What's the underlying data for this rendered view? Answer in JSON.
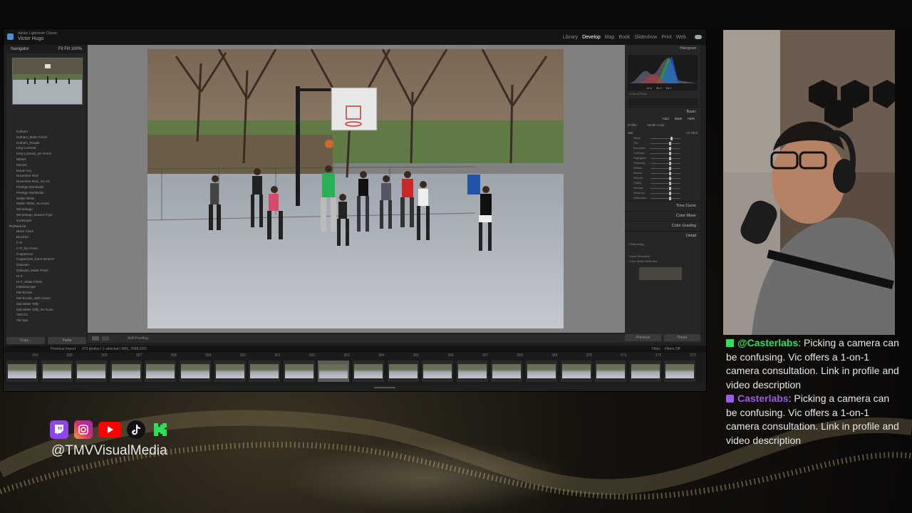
{
  "lightroom": {
    "app_name": "Adobe Lightroom Classic",
    "user_name": "Victor Hugo",
    "modules": [
      {
        "label": "Library",
        "active": false
      },
      {
        "label": "Develop",
        "active": true
      },
      {
        "label": "Map",
        "active": false
      },
      {
        "label": "Book",
        "active": false
      },
      {
        "label": "Slideshow",
        "active": false
      },
      {
        "label": "Print",
        "active": false
      },
      {
        "label": "Web",
        "active": false
      }
    ],
    "navigator": {
      "title": "Navigator",
      "zoom_options": [
        "Fit",
        "Fill",
        "100%"
      ]
    },
    "presets": [
      {
        "label": "Gotham",
        "group": false
      },
      {
        "label": "Gotham_Matte Finish",
        "group": false
      },
      {
        "label": "Gotham_People",
        "group": false
      },
      {
        "label": "King Contrast",
        "group": false
      },
      {
        "label": "King Contrast_No Green",
        "group": false
      },
      {
        "label": "MOMA",
        "group": false
      },
      {
        "label": "Montes",
        "group": false
      },
      {
        "label": "Mount Airy",
        "group": false
      },
      {
        "label": "November Rain",
        "group": false
      },
      {
        "label": "November Rain_No VG",
        "group": false
      },
      {
        "label": "Prestige Worldwide",
        "group": false
      },
      {
        "label": "Prestige Worldwide",
        "group": false
      },
      {
        "label": "Walter White",
        "group": false
      },
      {
        "label": "Walter White_No Grain",
        "group": false
      },
      {
        "label": "Winnebago",
        "group": false
      },
      {
        "label": "Winnebago_Erased Fogs",
        "group": false
      },
      {
        "label": "Zookeeper",
        "group": false
      },
      {
        "label": "ProPack 04",
        "group": true
      },
      {
        "label": "Blues Clues",
        "group": false
      },
      {
        "label": "Brooklyn",
        "group": false
      },
      {
        "label": "C-R",
        "group": false
      },
      {
        "label": "C-R_No Green",
        "group": false
      },
      {
        "label": "Coppertone",
        "group": false
      },
      {
        "label": "Coppertone_Extra Bronzer",
        "group": false
      },
      {
        "label": "Galaxian",
        "group": false
      },
      {
        "label": "Galaxian_Matte Finish",
        "group": false
      },
      {
        "label": "Hi-C",
        "group": false
      },
      {
        "label": "Hi-C_Matte Finish",
        "group": false
      },
      {
        "label": "Kaleidoscope",
        "group": false
      },
      {
        "label": "Mel Brooks",
        "group": false
      },
      {
        "label": "Mel Brooks_With Green",
        "group": false
      },
      {
        "label": "Salt Water Taffy",
        "group": false
      },
      {
        "label": "Salt Water Taffy_No Grain",
        "group": false
      },
      {
        "label": "TMCCC",
        "group": false
      },
      {
        "label": "Tiki Spa",
        "group": false
      }
    ],
    "left_buttons": {
      "copy": "Copy...",
      "paste": "Paste"
    },
    "toolbar": {
      "softproof": "Soft Proofing"
    },
    "right_panel": {
      "histogram_title": "Histogram",
      "histogram_readout": [
        "15.8",
        "35.4",
        "53.3"
      ],
      "original_photo": "Original Photo",
      "basic_title": "Basic",
      "treatment": [
        "Auto",
        "B&W",
        "HDR"
      ],
      "profile_label": "Profile",
      "profile_value": "Adobe Color",
      "wb_label": "WB",
      "wb_value": "As Shot",
      "sliders": [
        {
          "name": "Temp",
          "pos": 0.55
        },
        {
          "name": "Tint",
          "pos": 0.5
        },
        {
          "name": "Exposure",
          "pos": 0.5
        },
        {
          "name": "Contrast",
          "pos": 0.5
        },
        {
          "name": "Highlights",
          "pos": 0.5
        },
        {
          "name": "Shadows",
          "pos": 0.5
        },
        {
          "name": "Whites",
          "pos": 0.5
        },
        {
          "name": "Blacks",
          "pos": 0.5
        },
        {
          "name": "Texture",
          "pos": 0.5
        },
        {
          "name": "Clarity",
          "pos": 0.5
        },
        {
          "name": "Dehaze",
          "pos": 0.5
        },
        {
          "name": "Vibrance",
          "pos": 0.5
        },
        {
          "name": "Saturation",
          "pos": 0.5
        }
      ],
      "presence_label": "Presence",
      "tone_label": "Tone",
      "sections": [
        "Tone Curve",
        "Color Mixer",
        "Color Grading",
        "Detail"
      ],
      "detail_items": [
        "Sharpening",
        "Noise Reduction",
        "Color Noise Reduction"
      ],
      "buttons": {
        "previous": "Previous",
        "reset": "Reset"
      }
    },
    "filmbar": {
      "source": "Previous Import",
      "count": "473 photos / 1 selected / IMG_7998.CR3",
      "filter": "Filter:",
      "filter_value": "Filters Off"
    },
    "film_numbers": [
      "354",
      "355",
      "356",
      "357",
      "358",
      "359",
      "360",
      "361",
      "362",
      "363",
      "364",
      "365",
      "366",
      "367",
      "368",
      "369",
      "370",
      "371",
      "372",
      "373"
    ],
    "selected_index": 9
  },
  "chat": [
    {
      "platform": "kick",
      "user": "@Casterlabs",
      "text": ": Picking a camera can be confusing. Vic offers a 1-on-1 camera consultation. Link in profile and video description"
    },
    {
      "platform": "twitch",
      "user": "Casterlabs",
      "text": ": Picking a camera can be confusing. Vic offers a 1-on-1 camera consultation. Link in profile and video description"
    }
  ],
  "socials": {
    "handle": "@TMVVisualMedia",
    "icons": [
      "twitch-icon",
      "instagram-icon",
      "youtube-icon",
      "tiktok-icon",
      "kick-icon"
    ]
  },
  "colors": {
    "kick_green": "#2de05a",
    "twitch_purple": "#9b5de5"
  }
}
